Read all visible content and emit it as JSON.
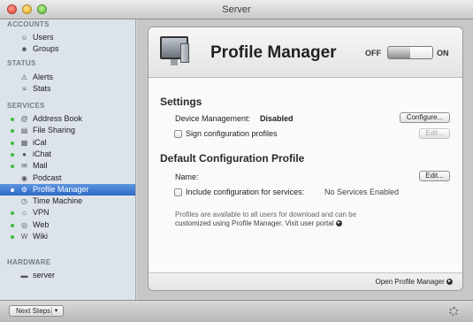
{
  "window": {
    "title": "Server"
  },
  "sidebar": {
    "sections": [
      {
        "heading": "ACCOUNTS",
        "items": [
          {
            "label": "Users",
            "icon": "users-icon",
            "dot": false
          },
          {
            "label": "Groups",
            "icon": "groups-icon",
            "dot": false
          }
        ]
      },
      {
        "heading": "STATUS",
        "items": [
          {
            "label": "Alerts",
            "icon": "alerts-icon",
            "dot": false
          },
          {
            "label": "Stats",
            "icon": "stats-icon",
            "dot": false
          }
        ]
      },
      {
        "heading": "SERVICES",
        "items": [
          {
            "label": "Address Book",
            "icon": "address-book-icon",
            "dot": true
          },
          {
            "label": "File Sharing",
            "icon": "file-sharing-icon",
            "dot": true
          },
          {
            "label": "iCal",
            "icon": "ical-icon",
            "dot": true
          },
          {
            "label": "iChat",
            "icon": "ichat-icon",
            "dot": true
          },
          {
            "label": "Mail",
            "icon": "mail-icon",
            "dot": true
          },
          {
            "label": "Podcast",
            "icon": "podcast-icon",
            "dot": false
          },
          {
            "label": "Profile Manager",
            "icon": "profile-manager-icon",
            "dot": true,
            "selected": true
          },
          {
            "label": "Time Machine",
            "icon": "time-machine-icon",
            "dot": false
          },
          {
            "label": "VPN",
            "icon": "vpn-icon",
            "dot": true
          },
          {
            "label": "Web",
            "icon": "web-icon",
            "dot": true
          },
          {
            "label": "Wiki",
            "icon": "wiki-icon",
            "dot": true
          }
        ]
      },
      {
        "heading": "HARDWARE",
        "items": [
          {
            "label": "server",
            "icon": "server-icon",
            "dot": false
          }
        ]
      }
    ]
  },
  "header": {
    "title": "Profile Manager",
    "toggle_off_label": "OFF",
    "toggle_on_label": "ON"
  },
  "settings": {
    "heading": "Settings",
    "device_management_label": "Device Management:",
    "device_management_value": "Disabled",
    "configure_button": "Configure...",
    "sign_profiles_label": "Sign configuration profiles",
    "sign_edit_button": "Edit..."
  },
  "default_profile": {
    "heading": "Default Configuration Profile",
    "name_label": "Name:",
    "name_edit_button": "Edit...",
    "include_label": "Include configuration for services:",
    "include_value": "No Services Enabled",
    "note_line1": "Profiles are available to all users for download and can be",
    "note_line2": "customized using Profile Manager. Visit user portal"
  },
  "footer": {
    "open_link": "Open Profile Manager"
  },
  "bottombar": {
    "next_steps": "Next Steps"
  },
  "colors": {
    "selection": "#2d68c7",
    "status_dot": "#3bbf3b"
  }
}
